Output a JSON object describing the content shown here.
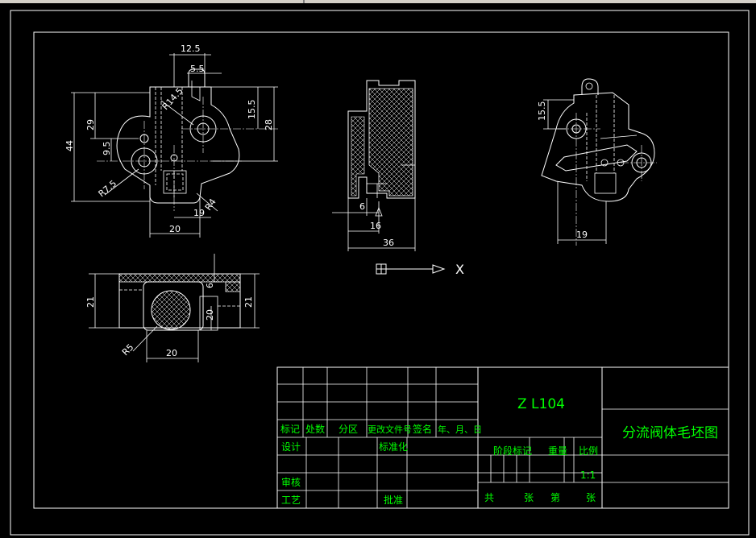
{
  "colors": {
    "background": "#000000",
    "lines": "#ffffff",
    "title_text": "#00ff00"
  },
  "dimensions": {
    "view1": {
      "d12_5": "12.5",
      "d5_5": "5.5",
      "r14_5": "R14.5",
      "d15_5": "15.5",
      "d29": "29",
      "d44": "44",
      "d28": "28",
      "d9_5": "9.5",
      "r7_5": "R7.5",
      "d19": "19",
      "d20": "20",
      "r4": "R4"
    },
    "view2": {
      "d6": "6",
      "d16": "16",
      "d36": "36"
    },
    "view3": {
      "d15_5": "15.5",
      "d19": "19"
    },
    "view4": {
      "d21_left": "21",
      "d21_right": "21",
      "d6": "6",
      "d20v": "20",
      "d20h": "20",
      "r5": "R5"
    }
  },
  "ucs": {
    "x_label": "X"
  },
  "title_block": {
    "drawing_number": "Z L104",
    "title": "分流阀体毛坯图",
    "headers": {
      "mark": "标记",
      "count": "处数",
      "zone": "分区",
      "doc": "更改文件号",
      "sign": "签名",
      "date": "年、月、日"
    },
    "design": "设计",
    "standardize": "标准化",
    "review": "审核",
    "process": "工艺",
    "approve": "批准",
    "stage_mark": "阶段标记",
    "weight": "重量",
    "scale_label": "比例",
    "scale": "1:1",
    "total": "共",
    "sheets": "张",
    "sheet_no": "第",
    "sheet": "张"
  }
}
